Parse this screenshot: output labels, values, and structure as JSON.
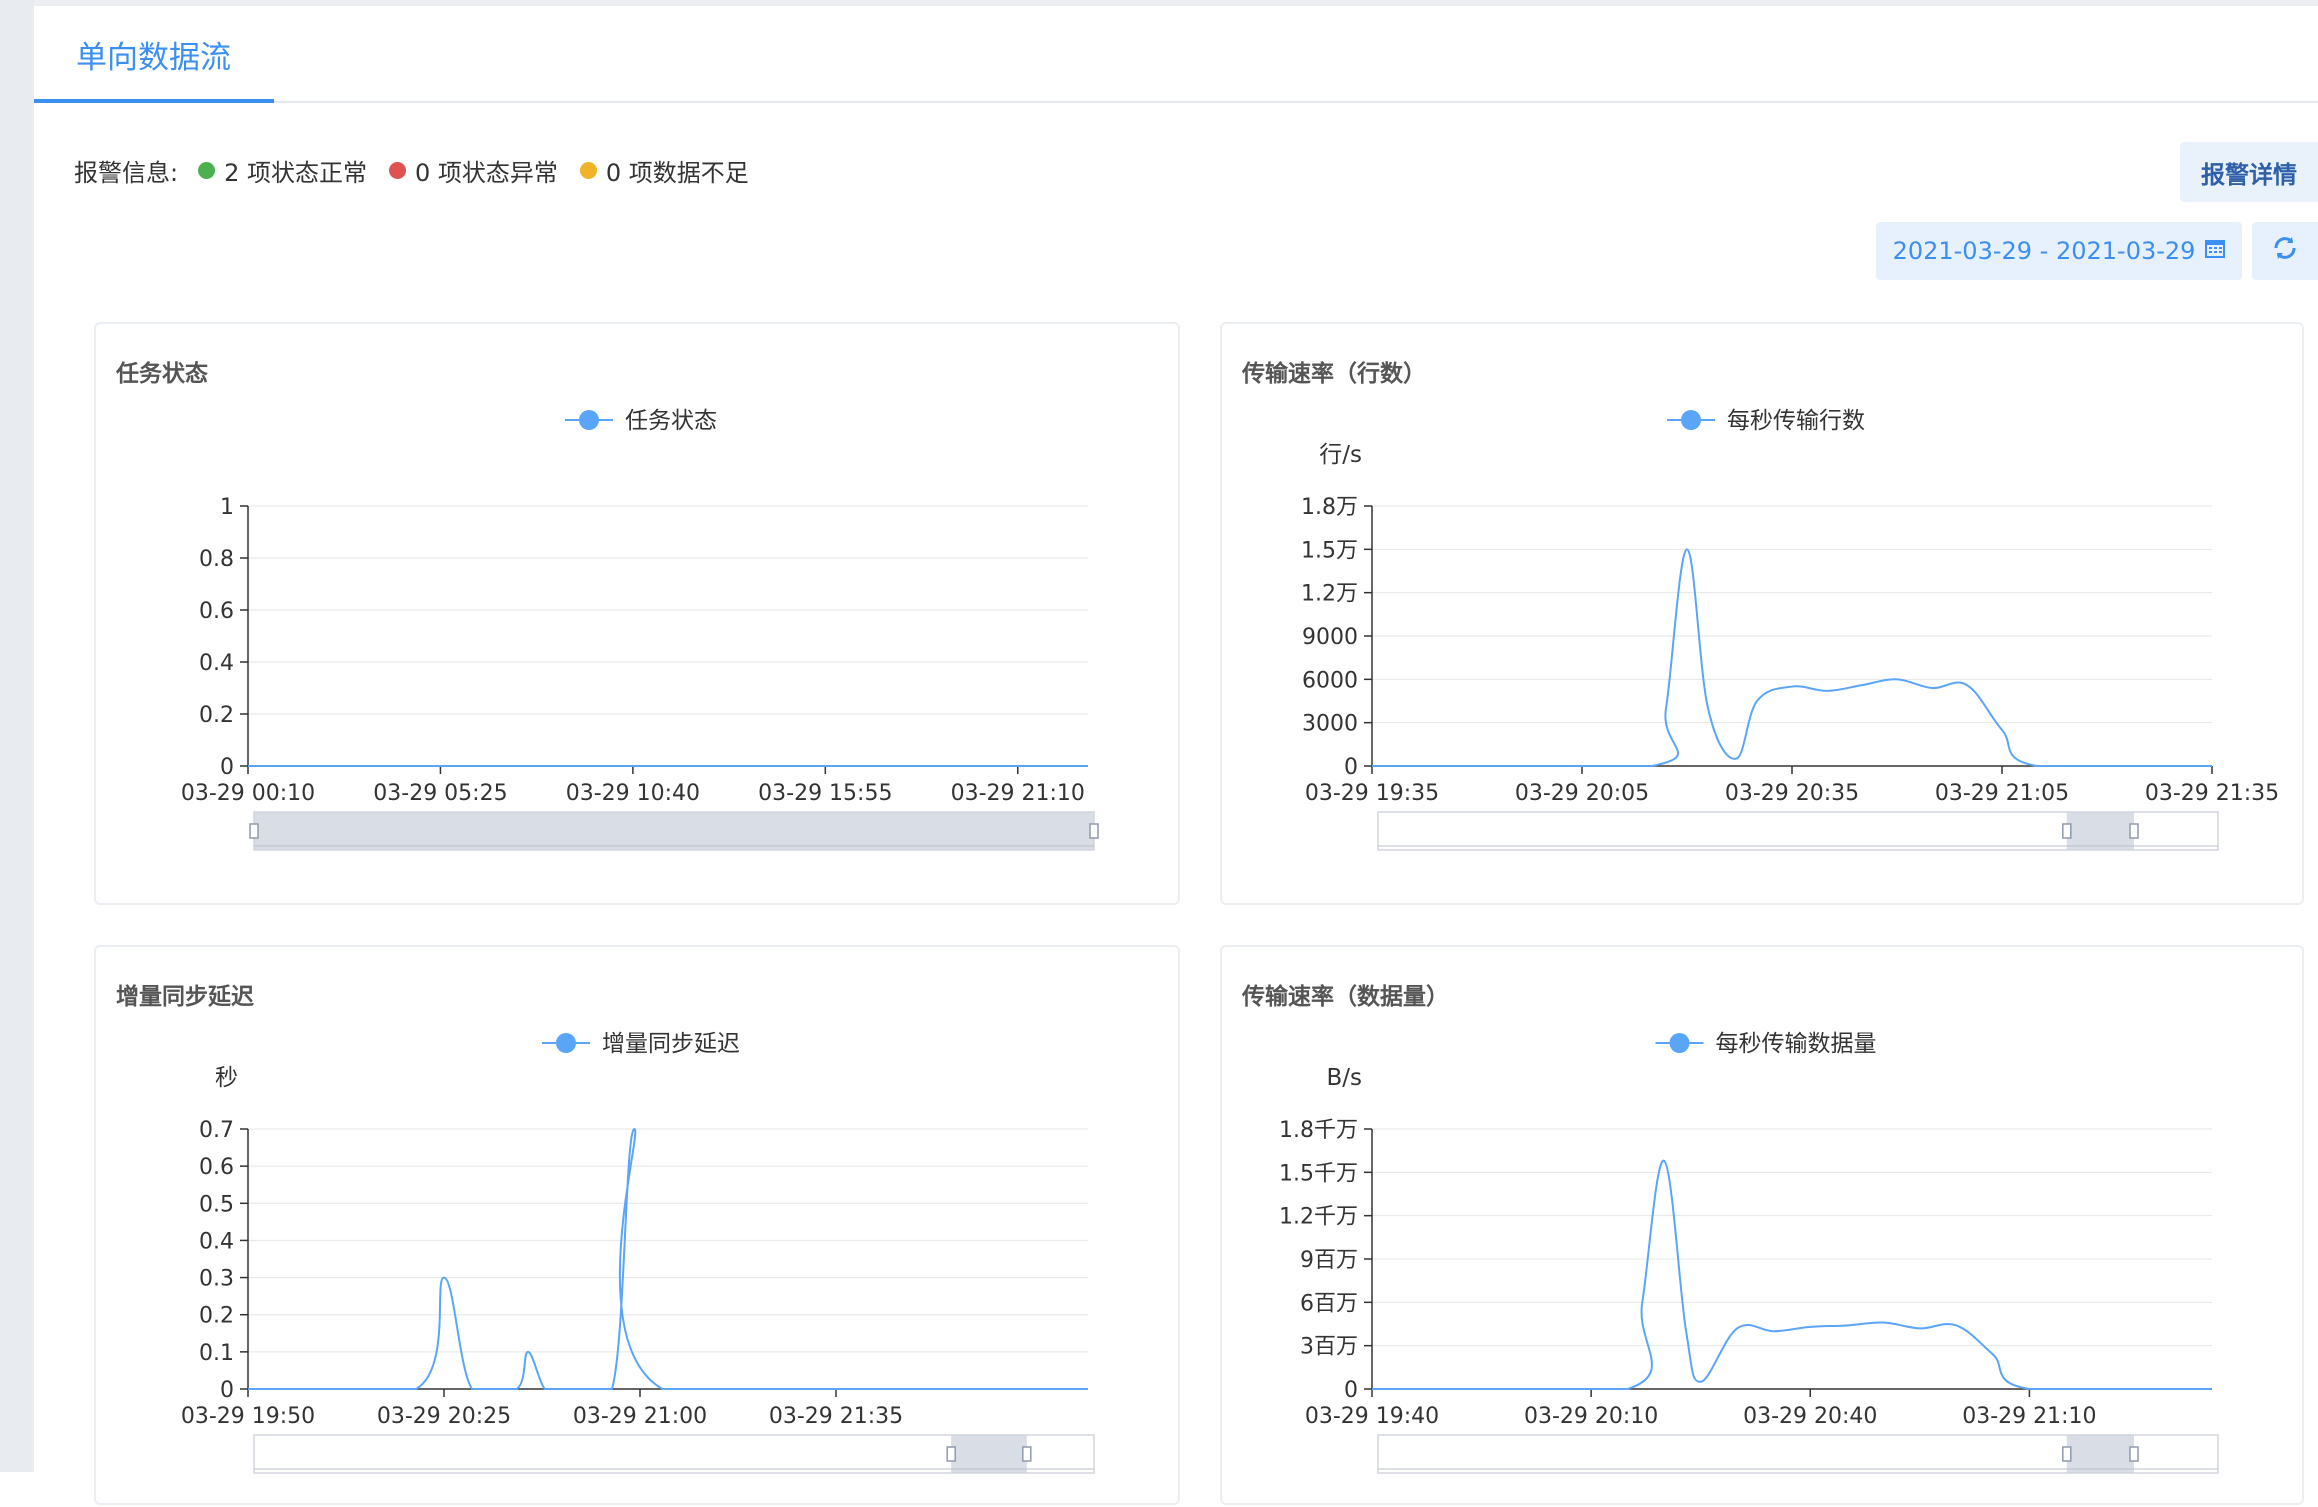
{
  "tabs": [
    {
      "label": "单向数据流"
    }
  ],
  "alarm": {
    "label": "报警信息:",
    "items": [
      {
        "text": "2 项状态正常",
        "color": "#4caf50"
      },
      {
        "text": "0 项状态异常",
        "color": "#e05252"
      },
      {
        "text": "0 项数据不足",
        "color": "#f0b429"
      }
    ],
    "detail_button": "报警详情"
  },
  "filter": {
    "date_range": "2021-03-29 - 2021-03-29",
    "calendar_icon": "calendar-icon",
    "refresh_icon": "refresh-icon"
  },
  "colors": {
    "accent": "#3b8ff0",
    "series": "#5aa5f7"
  },
  "charts": [
    {
      "card_title": "任务状态"
    },
    {
      "card_title": "传输速率（行数）"
    },
    {
      "card_title": "增量同步延迟"
    },
    {
      "card_title": "传输速率（数据量）"
    }
  ],
  "chart_data": [
    {
      "type": "line",
      "title": "任务状态",
      "legend": [
        "任务状态"
      ],
      "ylabel": "",
      "ylim": [
        0,
        1
      ],
      "yticks": [
        "0",
        "0.2",
        "0.4",
        "0.6",
        "0.8",
        "1"
      ],
      "ytick_values": [
        0,
        0.2,
        0.4,
        0.6,
        0.8,
        1
      ],
      "xticks": [
        "03-29 00:10",
        "03-29 05:25",
        "03-29 10:40",
        "03-29 15:55",
        "03-29 21:10"
      ],
      "xlim": [
        "03-29 00:10",
        "03-29 23:05"
      ],
      "series": [
        {
          "name": "任务状态",
          "x": [
            "03-29 00:10",
            "03-29 23:05"
          ],
          "values": [
            0,
            0
          ]
        }
      ],
      "slider_window": [
        0,
        1
      ]
    },
    {
      "type": "line",
      "title": "传输速率（行数）",
      "legend": [
        "每秒传输行数"
      ],
      "ylabel": "行/s",
      "ylim": [
        0,
        18000
      ],
      "yticks": [
        "0",
        "3000",
        "6000",
        "9000",
        "1.2万",
        "1.5万",
        "1.8万"
      ],
      "ytick_values": [
        0,
        3000,
        6000,
        9000,
        12000,
        15000,
        18000
      ],
      "xticks": [
        "03-29 19:35",
        "03-29 20:05",
        "03-29 20:35",
        "03-29 21:05",
        "03-29 21:35"
      ],
      "xlim": [
        "03-29 19:35",
        "03-29 21:35"
      ],
      "series": [
        {
          "name": "每秒传输行数",
          "x": [
            "03-29 19:35",
            "03-29 20:15",
            "03-29 20:17",
            "03-29 20:20",
            "03-29 20:23",
            "03-29 20:27",
            "03-29 20:30",
            "03-29 20:35",
            "03-29 20:40",
            "03-29 20:45",
            "03-29 20:50",
            "03-29 20:55",
            "03-29 21:00",
            "03-29 21:05",
            "03-29 21:10",
            "03-29 21:35"
          ],
          "values": [
            0,
            0,
            4000,
            15000,
            4000,
            500,
            4500,
            5500,
            5200,
            5600,
            6000,
            5400,
            5600,
            2500,
            0,
            0
          ]
        }
      ],
      "slider_window": [
        0.82,
        0.9
      ]
    },
    {
      "type": "line",
      "title": "增量同步延迟",
      "legend": [
        "增量同步延迟"
      ],
      "ylabel": "秒",
      "ylim": [
        0,
        0.7
      ],
      "yticks": [
        "0",
        "0.1",
        "0.2",
        "0.3",
        "0.4",
        "0.5",
        "0.6",
        "0.7"
      ],
      "ytick_values": [
        0,
        0.1,
        0.2,
        0.3,
        0.4,
        0.5,
        0.6,
        0.7
      ],
      "xticks": [
        "03-29 19:50",
        "03-29 20:25",
        "03-29 21:00",
        "03-29 21:35"
      ],
      "xlim": [
        "03-29 19:50",
        "03-29 22:20"
      ],
      "series": [
        {
          "name": "增量同步延迟",
          "x": [
            "03-29 19:50",
            "03-29 20:20",
            "03-29 20:25",
            "03-29 20:30",
            "03-29 20:38",
            "03-29 20:40",
            "03-29 20:43",
            "03-29 20:46",
            "03-29 20:55",
            "03-29 20:59",
            "03-29 21:04",
            "03-29 22:20"
          ],
          "values": [
            0,
            0,
            0.3,
            0,
            0,
            0.1,
            0,
            0,
            0,
            0.7,
            0,
            0
          ]
        }
      ],
      "slider_window": [
        0.83,
        0.92
      ]
    },
    {
      "type": "line",
      "title": "传输速率（数据量）",
      "legend": [
        "每秒传输数据量"
      ],
      "ylabel": "B/s",
      "ylim": [
        0,
        18000000
      ],
      "yticks": [
        "0",
        "3百万",
        "6百万",
        "9百万",
        "1.2千万",
        "1.5千万",
        "1.8千万"
      ],
      "ytick_values": [
        0,
        3000000,
        6000000,
        9000000,
        12000000,
        15000000,
        18000000
      ],
      "xticks": [
        "03-29 19:40",
        "03-29 20:10",
        "03-29 20:40",
        "03-29 21:10"
      ],
      "xlim": [
        "03-29 19:40",
        "03-29 21:35"
      ],
      "series": [
        {
          "name": "每秒传输数据量",
          "x": [
            "03-29 19:40",
            "03-29 20:15",
            "03-29 20:17",
            "03-29 20:20",
            "03-29 20:23",
            "03-29 20:25",
            "03-29 20:30",
            "03-29 20:35",
            "03-29 20:40",
            "03-29 20:45",
            "03-29 20:50",
            "03-29 20:55",
            "03-29 21:00",
            "03-29 21:05",
            "03-29 21:10",
            "03-29 21:35"
          ],
          "values": [
            0,
            0,
            6000000,
            15800000,
            4000000,
            500000,
            4200000,
            4000000,
            4300000,
            4400000,
            4600000,
            4200000,
            4400000,
            2400000,
            0,
            0
          ]
        }
      ],
      "slider_window": [
        0.82,
        0.9
      ]
    }
  ]
}
